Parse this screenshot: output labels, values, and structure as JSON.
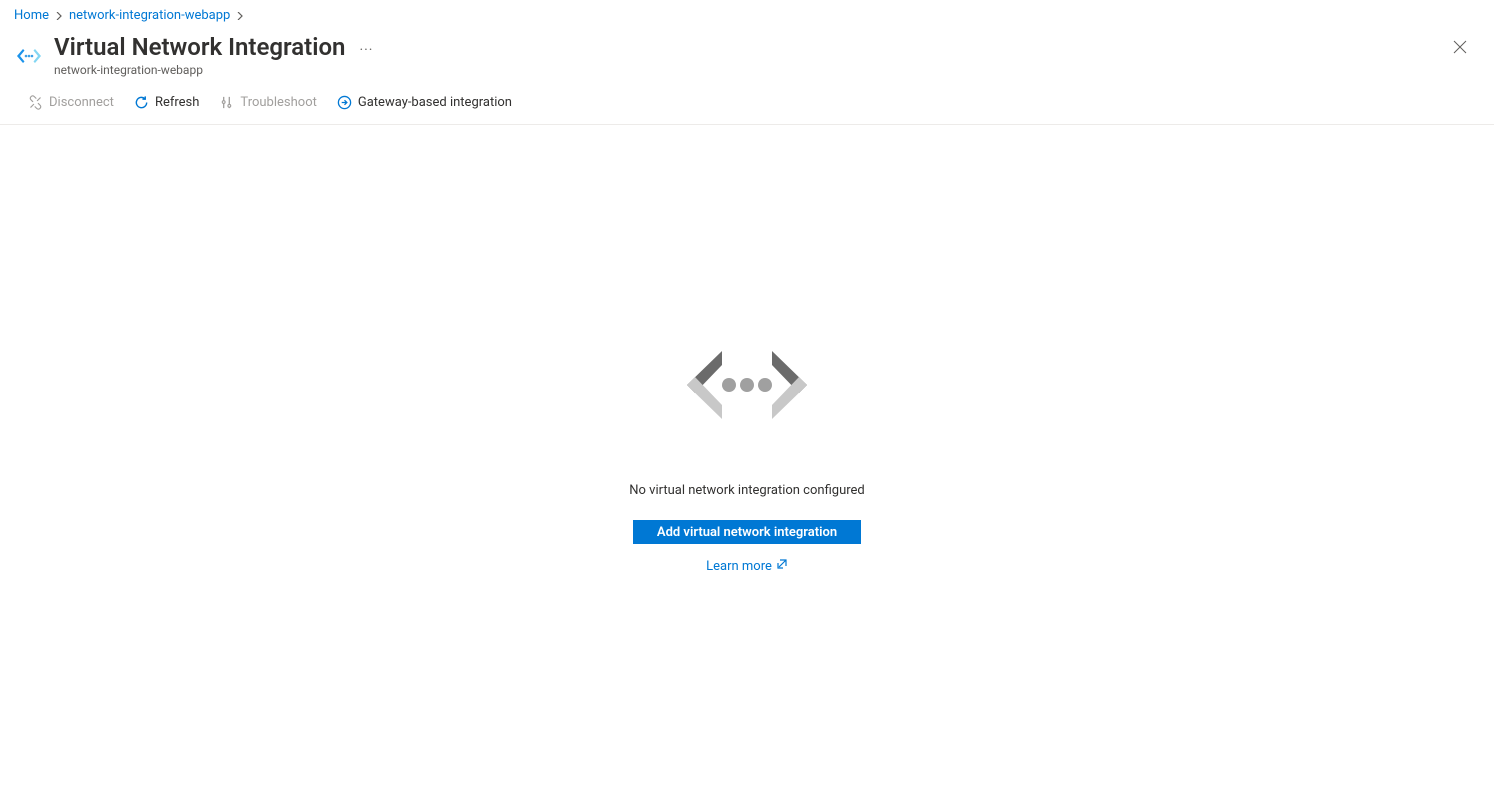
{
  "breadcrumb": {
    "home": "Home",
    "resource": "network-integration-webapp"
  },
  "header": {
    "title": "Virtual Network Integration",
    "subtitle": "network-integration-webapp"
  },
  "toolbar": {
    "disconnect": "Disconnect",
    "refresh": "Refresh",
    "troubleshoot": "Troubleshoot",
    "gateway": "Gateway-based integration"
  },
  "empty": {
    "message": "No virtual network integration configured",
    "add_button": "Add virtual network integration",
    "learn_more": "Learn more"
  }
}
